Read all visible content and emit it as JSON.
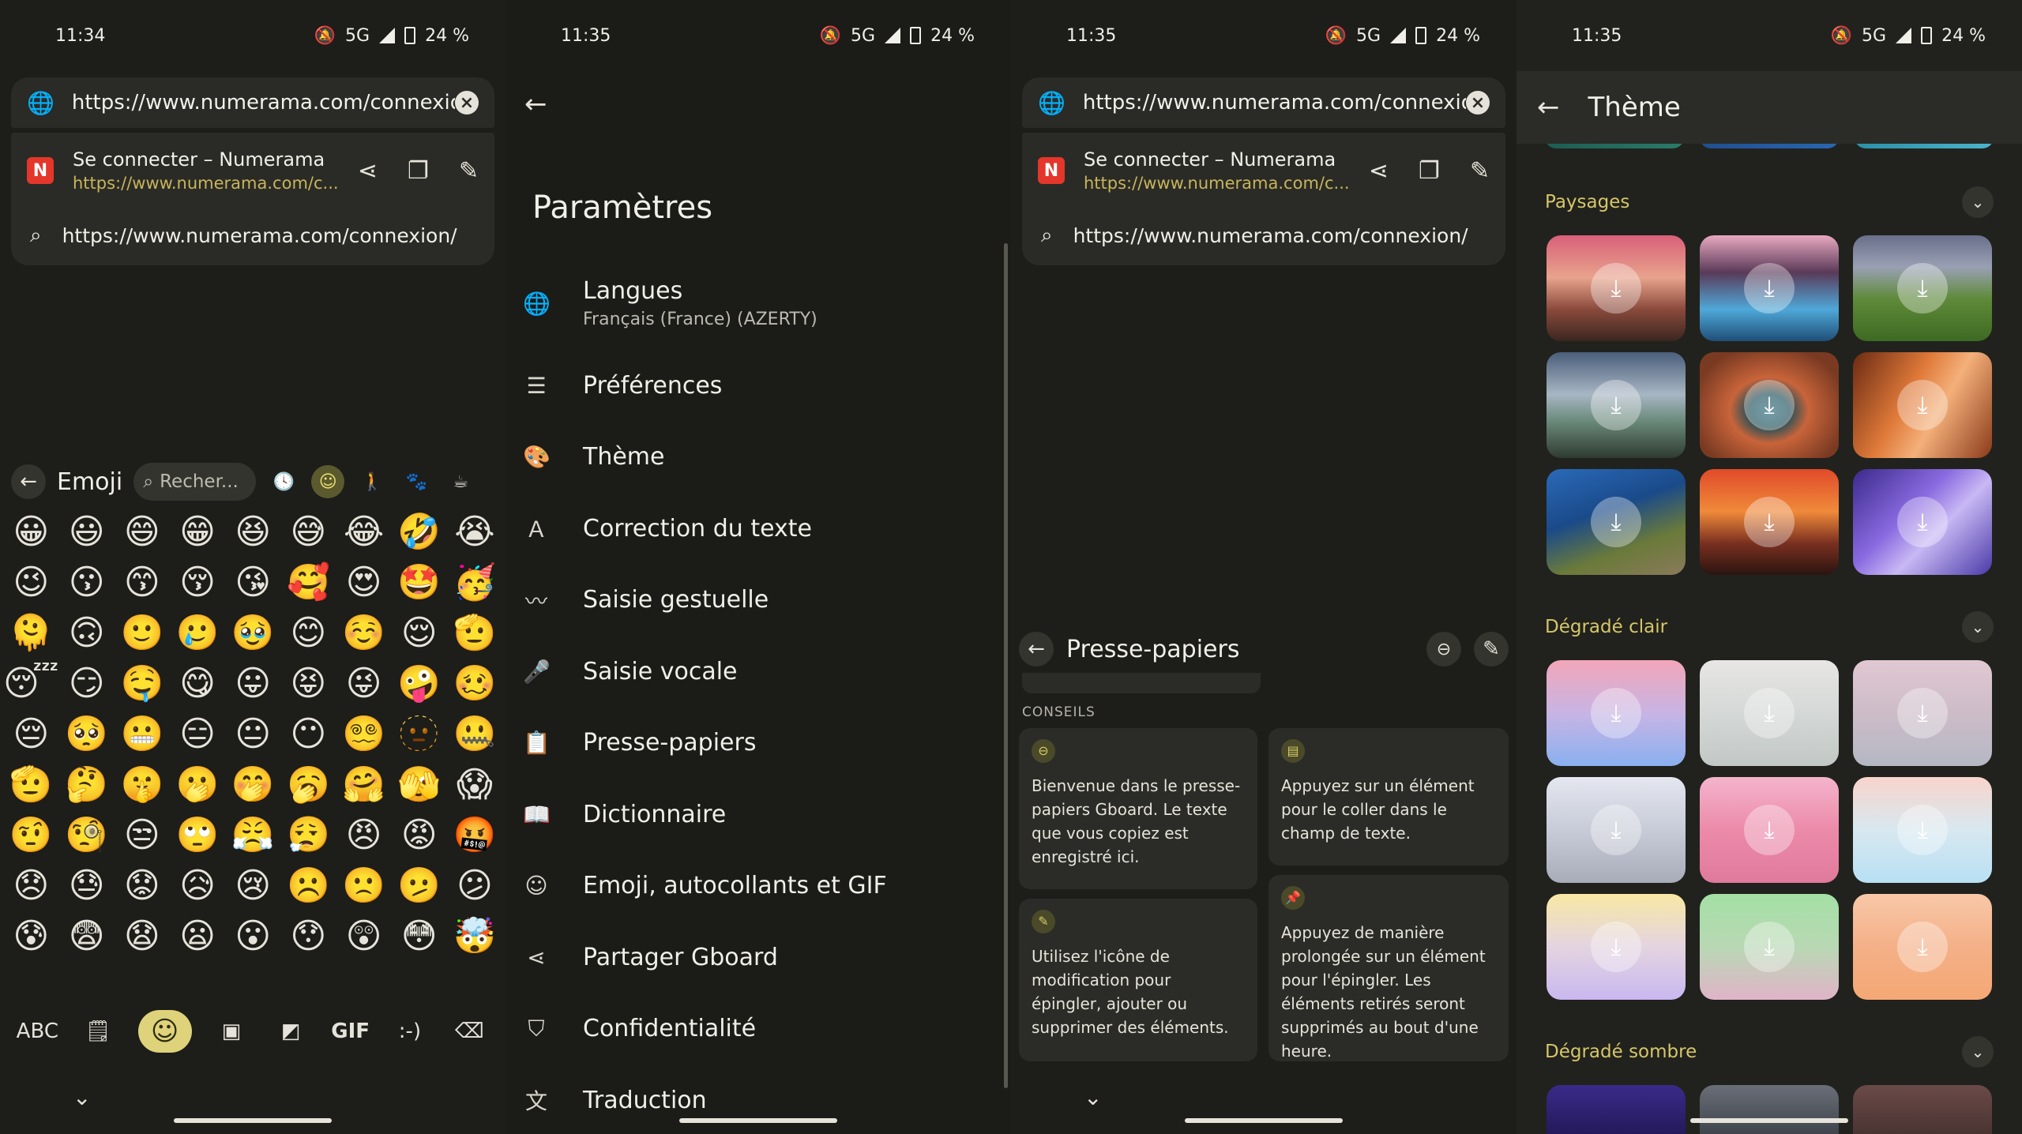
{
  "status_bar": [
    {
      "time": "11:34",
      "network": "5G",
      "battery": "24 %"
    },
    {
      "time": "11:35",
      "network": "5G",
      "battery": "24 %"
    },
    {
      "time": "11:35",
      "network": "5G",
      "battery": "24 %"
    },
    {
      "time": "11:35",
      "network": "5G",
      "battery": "24 %"
    }
  ],
  "browser": {
    "url": "https://www.numerama.com/connexion/",
    "suggestion_title": "Se connecter – Numerama",
    "suggestion_url": "https://www.numerama.com/c...",
    "favicon_letter": "N",
    "search_suggestion": "https://www.numerama.com/connexion/"
  },
  "emoji_keyboard": {
    "title": "Emoji",
    "search_placeholder": "Recher...",
    "emojis": [
      "😀",
      "😃",
      "😄",
      "😁",
      "😆",
      "😅",
      "😂",
      "🤣",
      "😭",
      "😉",
      "😗",
      "😙",
      "😚",
      "😘",
      "🥰",
      "😍",
      "🤩",
      "🥳",
      "🫠",
      "🙃",
      "🙂",
      "🥲",
      "🥹",
      "😊",
      "☺️",
      "😌",
      "🫡",
      "😴",
      "😏",
      "🤤",
      "😋",
      "😛",
      "😝",
      "😜",
      "🤪",
      "🥴",
      "😔",
      "🥺",
      "😬",
      "😑",
      "😐",
      "😶",
      "😵‍💫",
      "🫥",
      "🤐",
      "🫡",
      "🤔",
      "🤫",
      "🫢",
      "🤭",
      "🥱",
      "🤗",
      "🫣",
      "😱",
      "🤨",
      "🧐",
      "😒",
      "🙄",
      "😤",
      "😮‍💨",
      "😠",
      "😡",
      "🤬",
      "😞",
      "😓",
      "😟",
      "😥",
      "😢",
      "☹️",
      "🙁",
      "🫤",
      "😕",
      "😰",
      "😨",
      "😧",
      "😦",
      "😮",
      "😯",
      "😲",
      "😳",
      "🤯"
    ],
    "bottom": {
      "abc": "ABC",
      "gif": "GIF",
      "emoticon": ":-)"
    }
  },
  "settings": {
    "title": "Paramètres",
    "items": [
      {
        "label": "Langues",
        "sub": "Français (France) (AZERTY)",
        "icon": "globe-icon",
        "glyph": "🌐"
      },
      {
        "label": "Préférences",
        "sub": "",
        "icon": "sliders-icon",
        "glyph": "☰"
      },
      {
        "label": "Thème",
        "sub": "",
        "icon": "palette-icon",
        "glyph": "🎨"
      },
      {
        "label": "Correction du texte",
        "sub": "",
        "icon": "spellcheck-icon",
        "glyph": "Ａ"
      },
      {
        "label": "Saisie gestuelle",
        "sub": "",
        "icon": "gesture-icon",
        "glyph": "〰"
      },
      {
        "label": "Saisie vocale",
        "sub": "",
        "icon": "microphone-icon",
        "glyph": "🎤"
      },
      {
        "label": "Presse-papiers",
        "sub": "",
        "icon": "clipboard-icon",
        "glyph": "📋"
      },
      {
        "label": "Dictionnaire",
        "sub": "",
        "icon": "book-icon",
        "glyph": "📖"
      },
      {
        "label": "Emoji, autocollants et GIF",
        "sub": "",
        "icon": "emoji-icon",
        "glyph": "☺"
      },
      {
        "label": "Partager Gboard",
        "sub": "",
        "icon": "share-icon",
        "glyph": "⋖"
      },
      {
        "label": "Confidentialité",
        "sub": "",
        "icon": "shield-icon",
        "glyph": "⛉"
      },
      {
        "label": "Traduction",
        "sub": "",
        "icon": "translate-icon",
        "glyph": "文"
      }
    ]
  },
  "clipboard": {
    "title": "Presse-papiers",
    "section": "CONSEILS",
    "tips": [
      "Bienvenue dans le presse-papiers Gboard. Le texte que vous copiez est enregistré ici.",
      "Appuyez sur un élément pour le coller dans le champ de texte.",
      "Utilisez l'icône de modification pour épingler, ajouter ou supprimer des éléments.",
      "Appuyez de manière prolongée sur un élément pour l'épingler. Les éléments retirés seront supprimés au bout d'une heure."
    ]
  },
  "theme": {
    "title": "Thème",
    "sections": [
      {
        "name": "Paysages"
      },
      {
        "name": "Dégradé clair"
      },
      {
        "name": "Dégradé sombre"
      }
    ]
  }
}
